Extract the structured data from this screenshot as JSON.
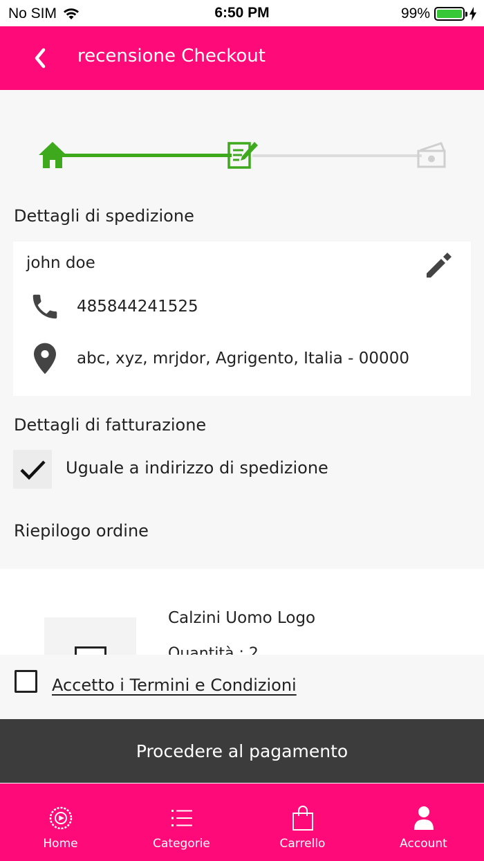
{
  "status_bar": {
    "carrier": "No SIM",
    "time": "6:50 PM",
    "battery": "99%"
  },
  "header": {
    "title": "recensione Checkout"
  },
  "stepper": {
    "steps": [
      "home-icon",
      "edit-document-icon",
      "payment-money-icon"
    ],
    "current_step": 2
  },
  "shipping": {
    "title": "Dettagli di spedizione",
    "name": "john doe",
    "phone": "485844241525",
    "address": "abc, xyz, mrjdor, Agrigento, Italia - 00000"
  },
  "billing": {
    "title": "Dettagli di fatturazione",
    "same_as_shipping_label": "Uguale a indirizzo di spedizione",
    "same_as_shipping_checked": true
  },
  "summary": {
    "title": "Riepilogo ordine",
    "product_name": "Calzini Uomo Logo",
    "product_qty": "Quantità : 2"
  },
  "terms": {
    "label": "Accetto i Termini e Condizioni",
    "checked": false
  },
  "actions": {
    "proceed_label": "Procedere al pagamento"
  },
  "tabbar": {
    "tabs": [
      {
        "label": "Home"
      },
      {
        "label": "Categorie"
      },
      {
        "label": "Carrello"
      },
      {
        "label": "Account"
      }
    ]
  },
  "colors": {
    "brand": "#ff0a78",
    "step_done": "#3fa91e",
    "step_todo": "#dcdcdc",
    "button_dark": "#3c3c3c"
  }
}
